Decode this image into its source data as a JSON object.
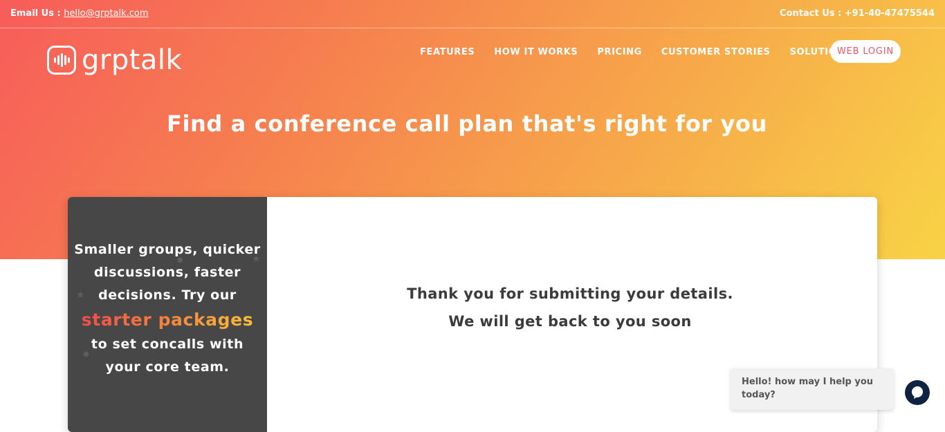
{
  "topbar": {
    "email_label": "Email Us :",
    "email_value": "hello@grptalk.com",
    "contact_label": "Contact Us :",
    "contact_value": "+91-40-47475544"
  },
  "brand": {
    "name": "grptalk",
    "logo_icon": "sound-wave-icon"
  },
  "nav": {
    "items": [
      "FEATURES",
      "HOW IT WORKS",
      "PRICING",
      "CUSTOMER STORIES",
      "SOLUTIONS"
    ],
    "login_label": "WEB LOGIN"
  },
  "hero": {
    "headline": "Find a conference call plan that's right for you"
  },
  "promo": {
    "line1": "Smaller groups, quicker",
    "line2": "discussions, faster",
    "line3": "decisions. Try our",
    "highlight": "starter packages",
    "line4": "to set concalls with",
    "line5": "your core team."
  },
  "confirmation": {
    "line1": "Thank you for submitting your details.",
    "line2": "We will get back to you soon"
  },
  "chat": {
    "greeting": "Hello! how may I help you today?",
    "icon": "chat-icon"
  },
  "colors": {
    "gradient_start": "#f75c5a",
    "gradient_end": "#f8d346",
    "login_text": "#f0566a",
    "promo_bg": "#474747",
    "chat_button": "#0f2241"
  }
}
